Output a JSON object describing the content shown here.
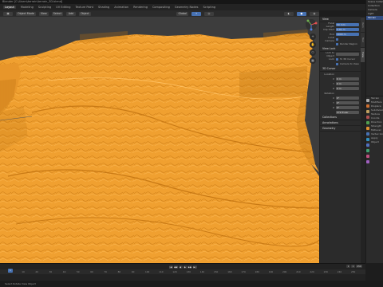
{
  "window": {
    "title": "Blender [C:\\Users\\terrain\\terrain_3D.blend]"
  },
  "workspaces": [
    "Layout",
    "Modeling",
    "Sculpting",
    "UV Editing",
    "Texture Paint",
    "Shading",
    "Animation",
    "Rendering",
    "Compositing",
    "Geometry Nodes",
    "Scripting"
  ],
  "workspace_active": "Layout",
  "header": {
    "mode": "Object Mode",
    "menus": [
      "View",
      "Select",
      "Add",
      "Object"
    ],
    "transform": "Global"
  },
  "npanel": {
    "sections": {
      "view": "View",
      "focal_label": "Focal Length",
      "focal_value": "50 mm",
      "clip_label": "Clip Start",
      "clip_value": "0.01 m",
      "clip_end_label": "End",
      "clip_end_value": "1000 m",
      "local_camera": "Local Camera",
      "render_region": "Render Region",
      "view_lock": "View Lock",
      "lock_obj": "Lock to Object",
      "lock_label": "Lock",
      "to_3d_cursor": "To 3D Cursor",
      "camera_to_view": "Camera to View",
      "cursor": "3D Cursor",
      "location": "Location",
      "x": "0 m",
      "y": "0 m",
      "z": "0 m",
      "rotation": "Rotation",
      "rx": "0°",
      "ry": "0°",
      "rz": "0°",
      "rotation_mode": "XYZ Euler",
      "collections": "Collections",
      "annotations": "Annotations",
      "geometry": "Geometry"
    }
  },
  "sidetabs": [
    "Item",
    "Tool",
    "View"
  ],
  "outliner": {
    "rows": [
      "Scene Collection",
      "Collection",
      "Camera",
      "Light",
      "Terrain"
    ],
    "selected": 4
  },
  "properties": {
    "rows": [
      "Terrain",
      "Modifiers",
      "Displace",
      "Subdivision",
      "Texture",
      "Coords",
      "Direction",
      "Strength",
      "Midlevel",
      "Vertex Group",
      "Apply",
      "Object"
    ]
  },
  "timeline": {
    "ticks": [
      "0",
      "10",
      "20",
      "30",
      "40",
      "50",
      "60",
      "70",
      "80",
      "90",
      "100",
      "110",
      "120",
      "130",
      "140",
      "150",
      "160",
      "170",
      "180",
      "190",
      "200",
      "210",
      "220",
      "230",
      "240",
      "250"
    ],
    "current": "1",
    "start": "1",
    "end": "250",
    "playback": [
      "|◀",
      "◀◀",
      "◀",
      "▶",
      "▶▶",
      "▶|"
    ]
  },
  "statusbar": "Select    Rotate View    Object",
  "colors": {
    "terrain": "#f0a030",
    "viewport_bg": "#3d3d3d",
    "accent": "#4772b3"
  }
}
